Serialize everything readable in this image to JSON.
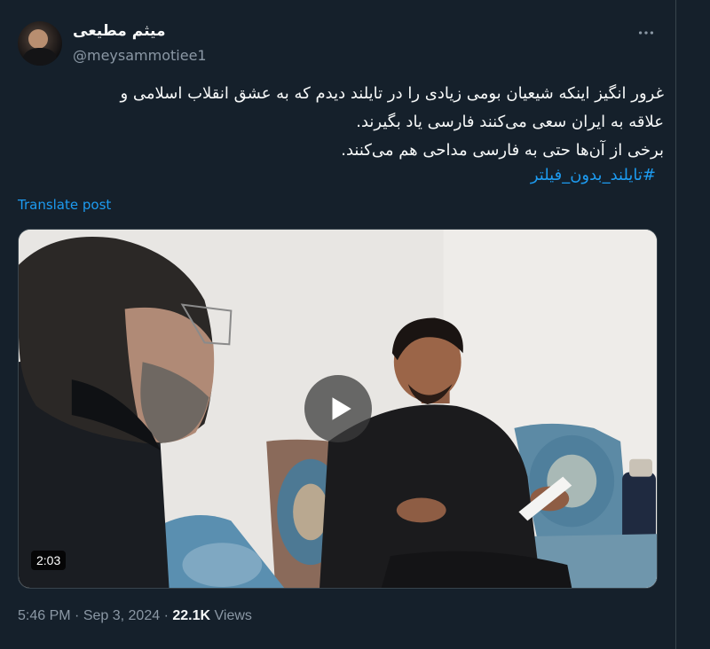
{
  "author": {
    "name": "میثم مطیعی",
    "handle": "@meysammotiee1"
  },
  "post": {
    "lines": [
      "غرور انگیز اینکه شیعیان بومی زیادی را در تایلند دیدم که به عشق انقلاب اسلامی و",
      "علاقه به ایران سعی می‌کنند فارسی یاد بگیرند.",
      "برخی از آن‌ها حتی به فارسی مداحی هم می‌کنند."
    ],
    "hashtag": "#تایلند_بدون_فیلتر",
    "translate_label": "Translate post"
  },
  "video": {
    "duration": "2:03"
  },
  "meta": {
    "time": "5:46 PM",
    "separator": "·",
    "date": "Sep 3, 2024",
    "views_count": "22.1K",
    "views_label": "Views"
  },
  "icons": {
    "more": "more-dots-icon",
    "play": "play-icon"
  }
}
